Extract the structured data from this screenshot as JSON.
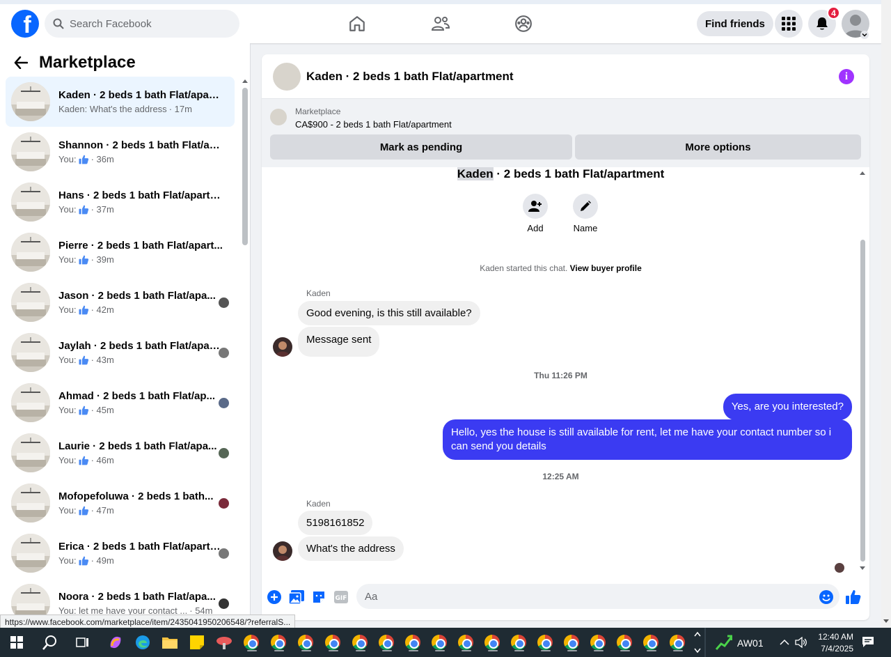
{
  "topbar": {
    "logo": "f",
    "search_placeholder": "Search Facebook",
    "find_friends": "Find friends",
    "notification_count": "4"
  },
  "sidebar": {
    "title": "Marketplace",
    "conversations": [
      {
        "title": "Kaden · 2 beds 1 bath Flat/apart...",
        "sub": "Kaden: What's the address",
        "time": "· 17m",
        "active": true
      },
      {
        "title": "Shannon · 2 beds 1 bath Flat/ap...",
        "sub": "You:",
        "time": "· 36m"
      },
      {
        "title": "Hans · 2 beds 1 bath Flat/apartm...",
        "sub": "You:",
        "time": "· 37m"
      },
      {
        "title": "Pierre · 2 beds 1 bath Flat/apart...",
        "sub": "You:",
        "time": "· 39m"
      },
      {
        "title": "Jason · 2 beds 1 bath Flat/apa...",
        "sub": "You:",
        "time": "· 42m"
      },
      {
        "title": "Jaylah · 2 beds 1 bath Flat/apart...",
        "sub": "You:",
        "time": "· 43m"
      },
      {
        "title": "Ahmad · 2 beds 1 bath Flat/ap...",
        "sub": "You:",
        "time": "· 45m"
      },
      {
        "title": "Laurie · 2 beds 1 bath Flat/apa...",
        "sub": "You:",
        "time": "· 46m"
      },
      {
        "title": "Mofopefoluwa · 2 beds 1 bath...",
        "sub": "You:",
        "time": "· 47m"
      },
      {
        "title": "Erica · 2 beds 1 bath Flat/apartm...",
        "sub": "You:",
        "time": "· 49m"
      },
      {
        "title": "Noora · 2 beds 1 bath Flat/apa...",
        "sub": "You: let me have your contact ...",
        "time": "· 54m"
      }
    ]
  },
  "chat": {
    "title": "Kaden · 2 beds 1 bath Flat/apartment",
    "marketplace_label": "Marketplace",
    "listing": "CA$900 - 2 beds 1 bath Flat/apartment",
    "mark_pending": "Mark as pending",
    "more_options": "More options",
    "group_name_highlight": "Kaden",
    "group_name_rest": " · 2 beds 1 bath Flat/apartment",
    "add_label": "Add",
    "name_label": "Name",
    "started": "Kaden started this chat.",
    "view_profile": "View buyer profile",
    "sender1": "Kaden",
    "msg1": "Good evening, is this still available?",
    "msg2": "Message sent",
    "time1": "Thu 11:26 PM",
    "out1": "Yes, are you interested?",
    "out2": "Hello, yes the house is still available for rent, let me have your contact number so i can send you details",
    "time2": "12:25 AM",
    "sender2": "Kaden",
    "msg3": "5198161852",
    "msg4": "What's the address",
    "input_placeholder": "Aa"
  },
  "status_url": "https://www.facebook.com/marketplace/item/2435041950206548/?referralS...",
  "taskbar": {
    "tray_label": "AW01",
    "time": "12:40 AM",
    "date": "7/4/2025"
  },
  "colors": {
    "brand": "#0866ff",
    "outgoing_bubble": "#3b3bf2",
    "info_purple": "#a033ff",
    "badge_red": "#e41e3f"
  }
}
